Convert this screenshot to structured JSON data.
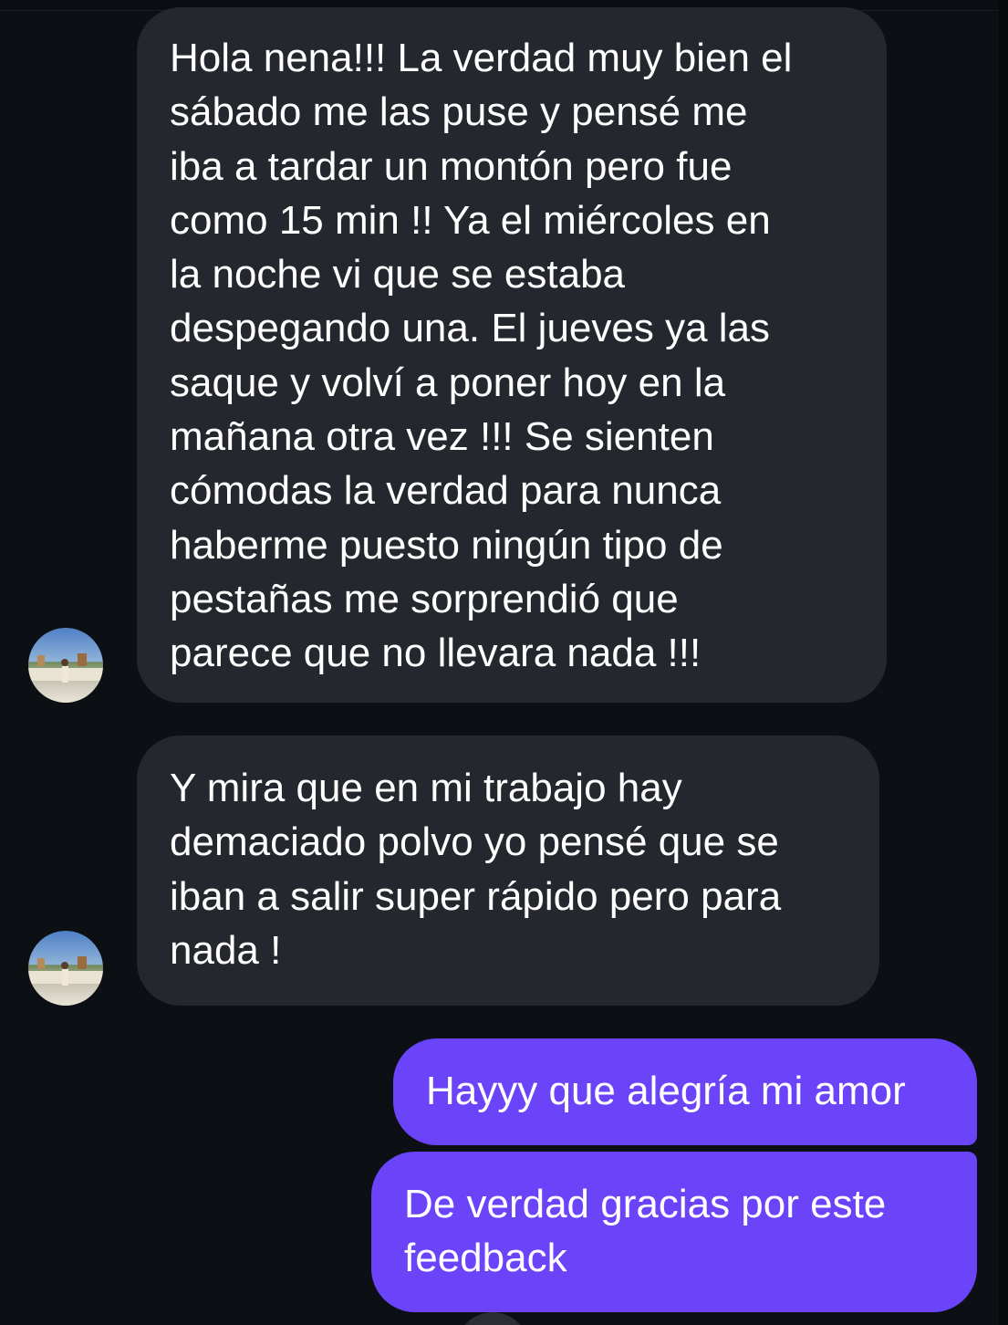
{
  "colors": {
    "background": "#0c0f14",
    "incoming_bubble": "#24272d",
    "outgoing_bubble": "#6b44f9",
    "text": "#ffffff"
  },
  "messages": [
    {
      "direction": "incoming",
      "avatar": "contact-avatar",
      "text": "Hola nena!!! La verdad muy bien el\nsábado me las puse y pensé me\niba a tardar un montón pero fue\ncomo 15 min !! Ya el miércoles en\nla noche vi que se estaba\ndespegando una. El jueves ya las\nsaque y volví a poner hoy en la\nmañana otra vez !!! Se sienten\ncómodas la verdad para nunca\nhaberme puesto ningún tipo de\npestañas me sorprendió que\nparece que no llevara nada !!!"
    },
    {
      "direction": "incoming",
      "avatar": "contact-avatar",
      "text": "Y mira que en mi trabajo hay\ndemaciado polvo yo pensé que se\niban a salir super rápido pero para\nnada !"
    },
    {
      "direction": "outgoing",
      "text": "Hayyy que alegría mi amor"
    },
    {
      "direction": "outgoing",
      "text": "De verdad gracias por este\nfeedback"
    }
  ]
}
